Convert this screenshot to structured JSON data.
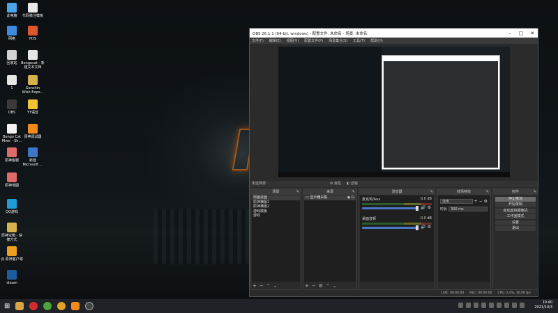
{
  "desktop": {
    "icons": [
      {
        "label": "此电脑",
        "color": "#4aa6e8"
      },
      {
        "label": "代码核注模板",
        "color": "#e8e8e8"
      },
      {
        "label": "网络",
        "color": "#3c8de0"
      },
      {
        "label": "PDS",
        "color": "#e0562c"
      },
      {
        "label": "回收站",
        "color": "#d2d2d2"
      },
      {
        "label": "Bongocat - 新建文本文档",
        "color": "#e6e6e6"
      },
      {
        "label": "1",
        "color": "#e6e6e6"
      },
      {
        "label": "Genshin Wish Expo...",
        "color": "#d4b14a"
      },
      {
        "label": "OBS",
        "color": "#3a3a3a"
      },
      {
        "label": "YY语音",
        "color": "#f1c232"
      },
      {
        "label": "Bongo Cat Mver - Sh...",
        "color": "#f2f2f2"
      },
      {
        "label": "原神调试器",
        "color": "#f08a1c"
      },
      {
        "label": "原神客服",
        "color": "#e06b6b"
      },
      {
        "label": "新建 Microsoft ...",
        "color": "#3d78c8"
      },
      {
        "label": "原神地图",
        "color": "#e06b6b"
      },
      {
        "label": "QQ游戏",
        "color": "#1e9bd8"
      },
      {
        "label": "原神宝箱 - 快捷方式",
        "color": "#d8b24a"
      },
      {
        "label": "云·原神客户端",
        "color": "#f0a020"
      },
      {
        "label": "steam",
        "color": "#1f5c9e"
      }
    ]
  },
  "obs": {
    "title": "OBS 26.1.1 (64-bit, windows) - 配置文件: 未命名 - 场景: 未命名",
    "menu": [
      "文件(F)",
      "编辑(E)",
      "视图(V)",
      "配置文件(P)",
      "场景集合(S)",
      "工具(T)",
      "帮助(H)"
    ],
    "scene_label": "未选择源",
    "scene_btns": [
      "属性",
      "滤镜"
    ],
    "docks": {
      "scenes": {
        "title": "场景",
        "items": [
          "电脑桌面",
          "原神横版1",
          "原神横版2",
          "游戏模板",
          "游戏"
        ]
      },
      "sources": {
        "title": "来源",
        "items": [
          "显示器采集"
        ]
      },
      "mixer": {
        "title": "混音器",
        "channels": [
          {
            "name": "麦克风/Aux",
            "db": "0.0 dB"
          },
          {
            "name": "桌面音频",
            "db": "0.0 dB"
          }
        ]
      },
      "transitions": {
        "title": "转场特效",
        "type": "淡出",
        "duration_label": "时长",
        "duration": "300 ms"
      },
      "controls": {
        "title": "控件",
        "buttons": [
          "停止推流",
          "开始录制",
          "启动虚拟摄像机",
          "工作室模式",
          "设置",
          "退出"
        ]
      }
    },
    "status": {
      "live": "LIVE: 00:00:00",
      "rec": "REC: 00:00:00",
      "cpu": "CPU: 2.4%, 30.00 fps"
    }
  },
  "taskbar": {
    "time": "10:40",
    "date": "2021/10/3"
  }
}
